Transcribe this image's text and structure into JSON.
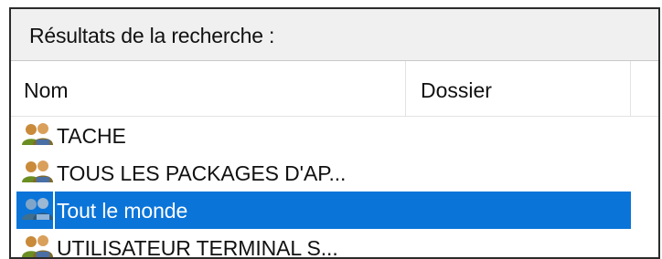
{
  "panel": {
    "title": "Résultats de la recherche :"
  },
  "columns": {
    "name": "Nom",
    "folder": "Dossier"
  },
  "rows": [
    {
      "label": "TACHE",
      "folder": "",
      "icon": "user-group-icon",
      "selected": false
    },
    {
      "label": "TOUS LES PACKAGES D'AP...",
      "folder": "",
      "icon": "user-group-icon",
      "selected": false
    },
    {
      "label": "Tout le monde",
      "folder": "",
      "icon": "user-group-icon",
      "selected": true
    },
    {
      "label": "UTILISATEUR TERMINAL S...",
      "folder": "",
      "icon": "user-group-icon",
      "selected": false
    }
  ],
  "colors": {
    "selection": "#0a74d9",
    "header_bg": "#f0f0f0"
  }
}
